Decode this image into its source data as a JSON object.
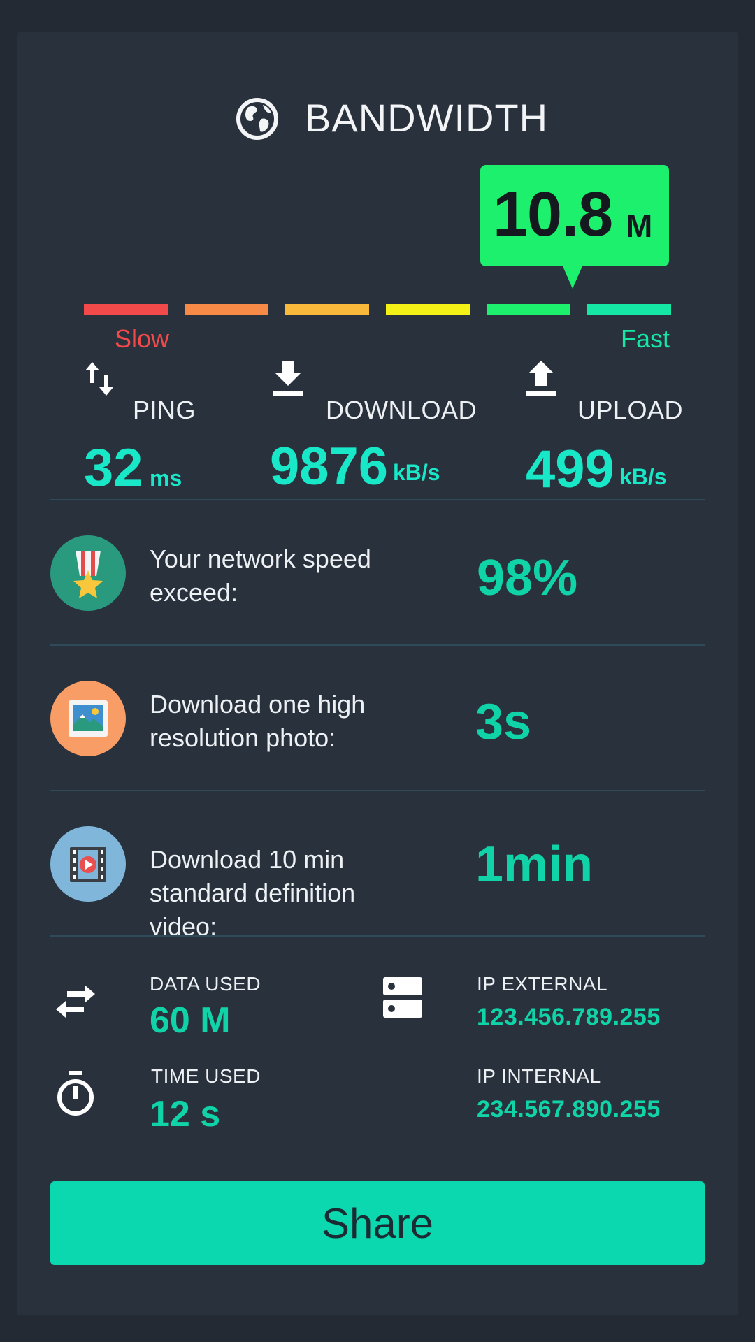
{
  "header": {
    "title": "BANDWIDTH",
    "icon": "globe-icon"
  },
  "speed": {
    "value": "10.8",
    "unit": "M"
  },
  "meter": {
    "segment_colors": [
      "#f24a4a",
      "#f88a48",
      "#f9b93a",
      "#f4f117",
      "#1df06c",
      "#14e8a4"
    ],
    "level_fraction": 0.83,
    "slow_label": "Slow",
    "slow_color": "#f24a4a",
    "fast_label": "Fast",
    "fast_color": "#14e8a4"
  },
  "stats": {
    "ping": {
      "label": "PING",
      "value": "32",
      "unit": "ms",
      "icon": "ping-arrows-icon"
    },
    "download": {
      "label": "DOWNLOAD",
      "value": "9876",
      "unit": "kB/s",
      "icon": "download-icon"
    },
    "upload": {
      "label": "UPLOAD",
      "value": "499",
      "unit": "kB/s",
      "icon": "upload-icon"
    }
  },
  "info": [
    {
      "text_line1": "Your network speed",
      "text_line2": "exceed:",
      "text_line3": "",
      "value": "98%",
      "icon": "medal-icon",
      "color": "#2a9a7e"
    },
    {
      "text_line1": "Download one high",
      "text_line2": "resolution photo:",
      "text_line3": "",
      "value": "3s",
      "icon": "photo-icon",
      "color": "#f89d66"
    },
    {
      "text_line1": "Download 10 min",
      "text_line2": "standard definition",
      "text_line3": "video:",
      "value": "1min",
      "icon": "video-icon",
      "color": "#7fb6d9"
    }
  ],
  "usage": {
    "data_used_label": "DATA USED",
    "data_used_value": "60 M",
    "time_used_label": "TIME USED",
    "time_used_value": "12 s",
    "ip_external_label": "IP EXTERNAL",
    "ip_external_value": "123.456.789.255",
    "ip_internal_label": "IP INTERNAL",
    "ip_internal_value": "234.567.890.255"
  },
  "share_label": "Share"
}
